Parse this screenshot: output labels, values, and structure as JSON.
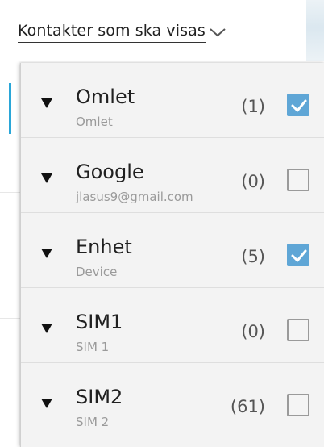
{
  "header": {
    "title": "Kontakter som ska visas",
    "dropdown_icon": "chevron-down-icon"
  },
  "accounts": [
    {
      "name": "Omlet",
      "subtitle": "Omlet",
      "count": "(1)",
      "checked": true
    },
    {
      "name": "Google",
      "subtitle": "jlasus9@gmail.com",
      "count": "(0)",
      "checked": false
    },
    {
      "name": "Enhet",
      "subtitle": "Device",
      "count": "(5)",
      "checked": true
    },
    {
      "name": "SIM1",
      "subtitle": "SIM 1",
      "count": "(0)",
      "checked": false
    },
    {
      "name": "SIM2",
      "subtitle": "SIM 2",
      "count": "(61)",
      "checked": false
    }
  ],
  "colors": {
    "accent": "#2aa6d8",
    "checkbox_on": "#5fa6d6"
  }
}
